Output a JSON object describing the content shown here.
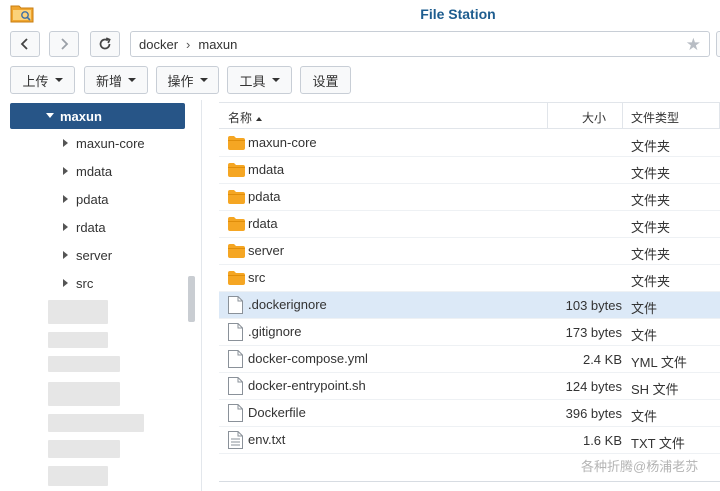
{
  "app": {
    "title": "File Station",
    "icon": "folder-app-icon"
  },
  "nav": {
    "back_icon": "chevron-left-icon",
    "forward_icon": "chevron-right-icon",
    "refresh_icon": "refresh-icon",
    "path": [
      "docker",
      "maxun"
    ],
    "path_separator": "›",
    "favorite_icon": "star-icon",
    "favorite_glyph": "★"
  },
  "toolbar": {
    "upload": "上传",
    "create": "新增",
    "action": "操作",
    "tools": "工具",
    "settings": "设置"
  },
  "sidebar": {
    "selected": "maxun",
    "children": [
      "maxun-core",
      "mdata",
      "pdata",
      "rdata",
      "server",
      "src"
    ]
  },
  "columns": {
    "name": "名称",
    "size": "大小",
    "type": "文件类型"
  },
  "files": [
    {
      "name": "maxun-core",
      "size": "",
      "type": "文件夹",
      "kind": "folder"
    },
    {
      "name": "mdata",
      "size": "",
      "type": "文件夹",
      "kind": "folder"
    },
    {
      "name": "pdata",
      "size": "",
      "type": "文件夹",
      "kind": "folder"
    },
    {
      "name": "rdata",
      "size": "",
      "type": "文件夹",
      "kind": "folder"
    },
    {
      "name": "server",
      "size": "",
      "type": "文件夹",
      "kind": "folder"
    },
    {
      "name": "src",
      "size": "",
      "type": "文件夹",
      "kind": "folder"
    },
    {
      "name": ".dockerignore",
      "size": "103 bytes",
      "type": "文件",
      "kind": "file",
      "selected": true
    },
    {
      "name": ".gitignore",
      "size": "173 bytes",
      "type": "文件",
      "kind": "file"
    },
    {
      "name": "docker-compose.yml",
      "size": "2.4 KB",
      "type": "YML 文件",
      "kind": "file"
    },
    {
      "name": "docker-entrypoint.sh",
      "size": "124 bytes",
      "type": "SH 文件",
      "kind": "file"
    },
    {
      "name": "Dockerfile",
      "size": "396 bytes",
      "type": "文件",
      "kind": "file"
    },
    {
      "name": "env.txt",
      "size": "1.6 KB",
      "type": "TXT 文件",
      "kind": "text-file"
    }
  ],
  "colors": {
    "accent": "#275587",
    "title": "#1e5d8f",
    "folder": "#f5a623",
    "selection": "#dce9f7"
  },
  "watermark": "各种折腾@杨浦老苏"
}
